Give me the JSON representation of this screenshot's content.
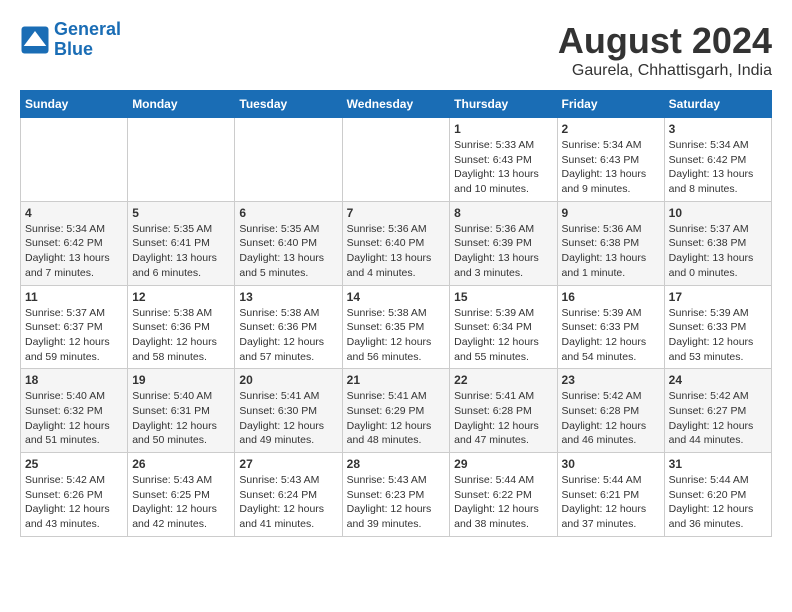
{
  "header": {
    "logo_line1": "General",
    "logo_line2": "Blue",
    "month_title": "August 2024",
    "location": "Gaurela, Chhattisgarh, India"
  },
  "days_of_week": [
    "Sunday",
    "Monday",
    "Tuesday",
    "Wednesday",
    "Thursday",
    "Friday",
    "Saturday"
  ],
  "weeks": [
    [
      {
        "day": "",
        "info": ""
      },
      {
        "day": "",
        "info": ""
      },
      {
        "day": "",
        "info": ""
      },
      {
        "day": "",
        "info": ""
      },
      {
        "day": "1",
        "info": "Sunrise: 5:33 AM\nSunset: 6:43 PM\nDaylight: 13 hours\nand 10 minutes."
      },
      {
        "day": "2",
        "info": "Sunrise: 5:34 AM\nSunset: 6:43 PM\nDaylight: 13 hours\nand 9 minutes."
      },
      {
        "day": "3",
        "info": "Sunrise: 5:34 AM\nSunset: 6:42 PM\nDaylight: 13 hours\nand 8 minutes."
      }
    ],
    [
      {
        "day": "4",
        "info": "Sunrise: 5:34 AM\nSunset: 6:42 PM\nDaylight: 13 hours\nand 7 minutes."
      },
      {
        "day": "5",
        "info": "Sunrise: 5:35 AM\nSunset: 6:41 PM\nDaylight: 13 hours\nand 6 minutes."
      },
      {
        "day": "6",
        "info": "Sunrise: 5:35 AM\nSunset: 6:40 PM\nDaylight: 13 hours\nand 5 minutes."
      },
      {
        "day": "7",
        "info": "Sunrise: 5:36 AM\nSunset: 6:40 PM\nDaylight: 13 hours\nand 4 minutes."
      },
      {
        "day": "8",
        "info": "Sunrise: 5:36 AM\nSunset: 6:39 PM\nDaylight: 13 hours\nand 3 minutes."
      },
      {
        "day": "9",
        "info": "Sunrise: 5:36 AM\nSunset: 6:38 PM\nDaylight: 13 hours\nand 1 minute."
      },
      {
        "day": "10",
        "info": "Sunrise: 5:37 AM\nSunset: 6:38 PM\nDaylight: 13 hours\nand 0 minutes."
      }
    ],
    [
      {
        "day": "11",
        "info": "Sunrise: 5:37 AM\nSunset: 6:37 PM\nDaylight: 12 hours\nand 59 minutes."
      },
      {
        "day": "12",
        "info": "Sunrise: 5:38 AM\nSunset: 6:36 PM\nDaylight: 12 hours\nand 58 minutes."
      },
      {
        "day": "13",
        "info": "Sunrise: 5:38 AM\nSunset: 6:36 PM\nDaylight: 12 hours\nand 57 minutes."
      },
      {
        "day": "14",
        "info": "Sunrise: 5:38 AM\nSunset: 6:35 PM\nDaylight: 12 hours\nand 56 minutes."
      },
      {
        "day": "15",
        "info": "Sunrise: 5:39 AM\nSunset: 6:34 PM\nDaylight: 12 hours\nand 55 minutes."
      },
      {
        "day": "16",
        "info": "Sunrise: 5:39 AM\nSunset: 6:33 PM\nDaylight: 12 hours\nand 54 minutes."
      },
      {
        "day": "17",
        "info": "Sunrise: 5:39 AM\nSunset: 6:33 PM\nDaylight: 12 hours\nand 53 minutes."
      }
    ],
    [
      {
        "day": "18",
        "info": "Sunrise: 5:40 AM\nSunset: 6:32 PM\nDaylight: 12 hours\nand 51 minutes."
      },
      {
        "day": "19",
        "info": "Sunrise: 5:40 AM\nSunset: 6:31 PM\nDaylight: 12 hours\nand 50 minutes."
      },
      {
        "day": "20",
        "info": "Sunrise: 5:41 AM\nSunset: 6:30 PM\nDaylight: 12 hours\nand 49 minutes."
      },
      {
        "day": "21",
        "info": "Sunrise: 5:41 AM\nSunset: 6:29 PM\nDaylight: 12 hours\nand 48 minutes."
      },
      {
        "day": "22",
        "info": "Sunrise: 5:41 AM\nSunset: 6:28 PM\nDaylight: 12 hours\nand 47 minutes."
      },
      {
        "day": "23",
        "info": "Sunrise: 5:42 AM\nSunset: 6:28 PM\nDaylight: 12 hours\nand 46 minutes."
      },
      {
        "day": "24",
        "info": "Sunrise: 5:42 AM\nSunset: 6:27 PM\nDaylight: 12 hours\nand 44 minutes."
      }
    ],
    [
      {
        "day": "25",
        "info": "Sunrise: 5:42 AM\nSunset: 6:26 PM\nDaylight: 12 hours\nand 43 minutes."
      },
      {
        "day": "26",
        "info": "Sunrise: 5:43 AM\nSunset: 6:25 PM\nDaylight: 12 hours\nand 42 minutes."
      },
      {
        "day": "27",
        "info": "Sunrise: 5:43 AM\nSunset: 6:24 PM\nDaylight: 12 hours\nand 41 minutes."
      },
      {
        "day": "28",
        "info": "Sunrise: 5:43 AM\nSunset: 6:23 PM\nDaylight: 12 hours\nand 39 minutes."
      },
      {
        "day": "29",
        "info": "Sunrise: 5:44 AM\nSunset: 6:22 PM\nDaylight: 12 hours\nand 38 minutes."
      },
      {
        "day": "30",
        "info": "Sunrise: 5:44 AM\nSunset: 6:21 PM\nDaylight: 12 hours\nand 37 minutes."
      },
      {
        "day": "31",
        "info": "Sunrise: 5:44 AM\nSunset: 6:20 PM\nDaylight: 12 hours\nand 36 minutes."
      }
    ]
  ]
}
